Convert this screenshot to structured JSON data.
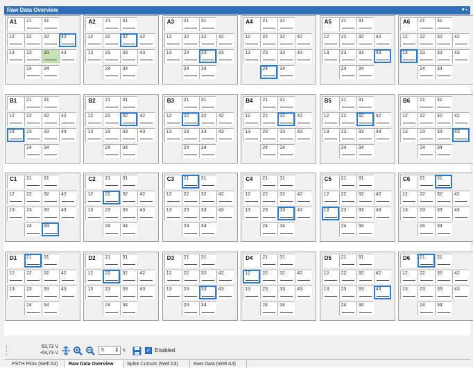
{
  "window": {
    "title": "Raw Data Overview",
    "pin_icon": "pin-icon"
  },
  "wells": [
    {
      "id": "A1"
    },
    {
      "id": "A2"
    },
    {
      "id": "A3"
    },
    {
      "id": "A4"
    },
    {
      "id": "A5"
    },
    {
      "id": "A6"
    },
    {
      "id": "B1"
    },
    {
      "id": "B2"
    },
    {
      "id": "B3"
    },
    {
      "id": "B4"
    },
    {
      "id": "B5"
    },
    {
      "id": "B6"
    },
    {
      "id": "C1"
    },
    {
      "id": "C2"
    },
    {
      "id": "C3"
    },
    {
      "id": "C4"
    },
    {
      "id": "C5"
    },
    {
      "id": "C6"
    },
    {
      "id": "D1"
    },
    {
      "id": "D2"
    },
    {
      "id": "D3"
    },
    {
      "id": "D4"
    },
    {
      "id": "D5"
    },
    {
      "id": "D6"
    }
  ],
  "electrodes": [
    [
      "",
      "21",
      "31",
      ""
    ],
    [
      "12",
      "22",
      "32",
      "42"
    ],
    [
      "13",
      "23",
      "33",
      "43"
    ],
    [
      "",
      "24",
      "34",
      ""
    ]
  ],
  "selected": {
    "A1": [
      "42"
    ],
    "A2": [
      "32"
    ],
    "A3": [
      "33"
    ],
    "A4": [
      "24"
    ],
    "A5": [
      "43"
    ],
    "A6": [
      "13"
    ],
    "B1": [
      "13"
    ],
    "B2": [
      "32"
    ],
    "B3": [
      "22"
    ],
    "B4": [
      "32"
    ],
    "B5": [
      "32"
    ],
    "B6": [
      "43"
    ],
    "C1": [
      "34"
    ],
    "C2": [
      "22"
    ],
    "C3": [
      "21"
    ],
    "C4": [
      "33"
    ],
    "C5": [
      "13"
    ],
    "C6": [
      "31"
    ],
    "D1": [
      "21"
    ],
    "D2": [
      "22"
    ],
    "D3": [
      "33"
    ],
    "D4": [
      "12"
    ],
    "D5": [
      "43"
    ],
    "D6": [
      "21"
    ]
  },
  "highlighted": {
    "A1": [
      "33"
    ]
  },
  "toolbar": {
    "voltage_max": "63,73 V",
    "voltage_min": "-63,73 V",
    "time_value": "5",
    "time_unit": "s",
    "enabled_label": "Enabled",
    "enabled_checked": true
  },
  "tabs": [
    {
      "label": "PSTH Plots (Well A3)",
      "active": false
    },
    {
      "label": "Raw Data Overview",
      "active": true
    },
    {
      "label": "Spike Cutouts (Well A3)",
      "active": false
    },
    {
      "label": "Raw Data (Well A3)",
      "active": false
    }
  ],
  "colors": {
    "accent": "#2f6fba",
    "selection": "#2a7bd0",
    "highlight": "#c6e3b5"
  }
}
